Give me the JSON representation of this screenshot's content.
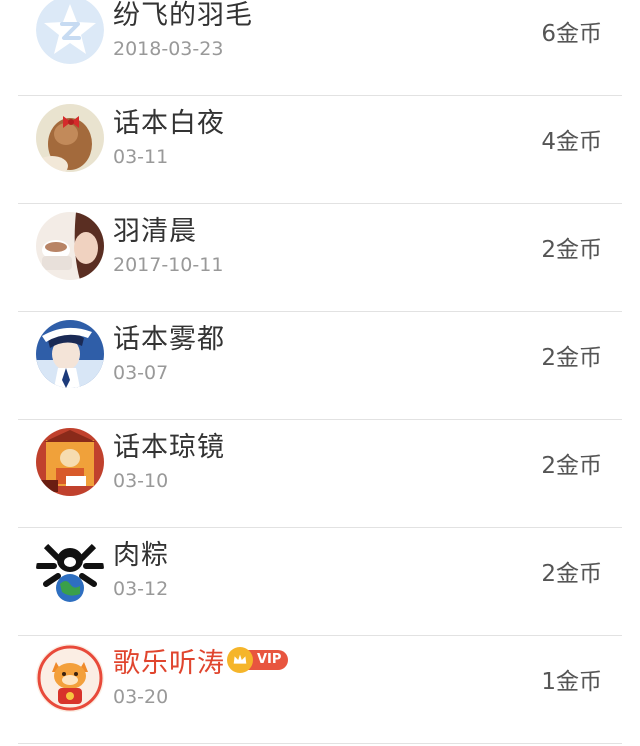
{
  "colors": {
    "separator": "#e2e2e2",
    "name_text": "#333333",
    "vip_name_text": "#e0452e",
    "date_text": "#999999",
    "coin_text": "#555555",
    "vip_tag": "#e8553f",
    "crown": "#f5b52a"
  },
  "items": [
    {
      "name": "纷飞的羽毛",
      "date": "2018-03-23",
      "coins": "6金币",
      "avatar_icon": "qq-star-icon",
      "vip": false
    },
    {
      "name": "话本白夜",
      "date": "03-11",
      "coins": "4金币",
      "avatar_icon": "girl-hairbow-avatar",
      "vip": false
    },
    {
      "name": "羽清晨",
      "date": "2017-10-11",
      "coins": "2金币",
      "avatar_icon": "girl-with-cup-avatar",
      "vip": false
    },
    {
      "name": "话本雾都",
      "date": "03-07",
      "coins": "2金币",
      "avatar_icon": "anime-kid-avatar",
      "vip": false
    },
    {
      "name": "话本琼镜",
      "date": "03-10",
      "coins": "2金币",
      "avatar_icon": "cartoon-monk-avatar",
      "vip": false
    },
    {
      "name": "肉粽",
      "date": "03-12",
      "coins": "2金币",
      "avatar_icon": "cartoon-earth-avatar",
      "vip": false
    },
    {
      "name": "歌乐听涛",
      "date": "03-20",
      "coins": "1金币",
      "avatar_icon": "lucky-cat-avatar",
      "vip": true,
      "vip_label": "VIP"
    }
  ]
}
